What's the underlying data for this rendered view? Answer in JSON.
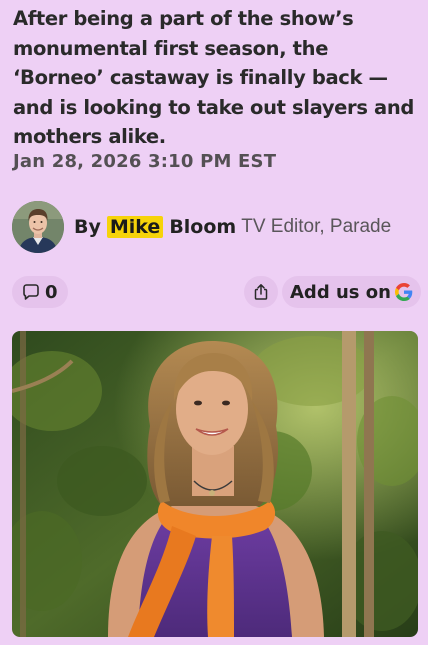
{
  "article": {
    "dek": "After being a part of the show’s monumental first season, the ‘Borneo’ castaway is finally back — and is looking to take out slayers and mothers alike.",
    "date": "Jan 28, 2026 3:10 PM EST",
    "byline": {
      "prefix": "By",
      "author_first": "Mike",
      "author_last": "Bloom",
      "role": "TV Editor, Parade"
    },
    "actions": {
      "comment_count": "0",
      "add_us_label": "Add us on",
      "comment_icon": "speech-bubble-icon",
      "share_icon": "share-upload-icon",
      "google_icon": "google-g-logo"
    }
  },
  "colors": {
    "background": "#eed0f5",
    "pill": "#e5c3ec",
    "highlight": "#f6d30a"
  }
}
